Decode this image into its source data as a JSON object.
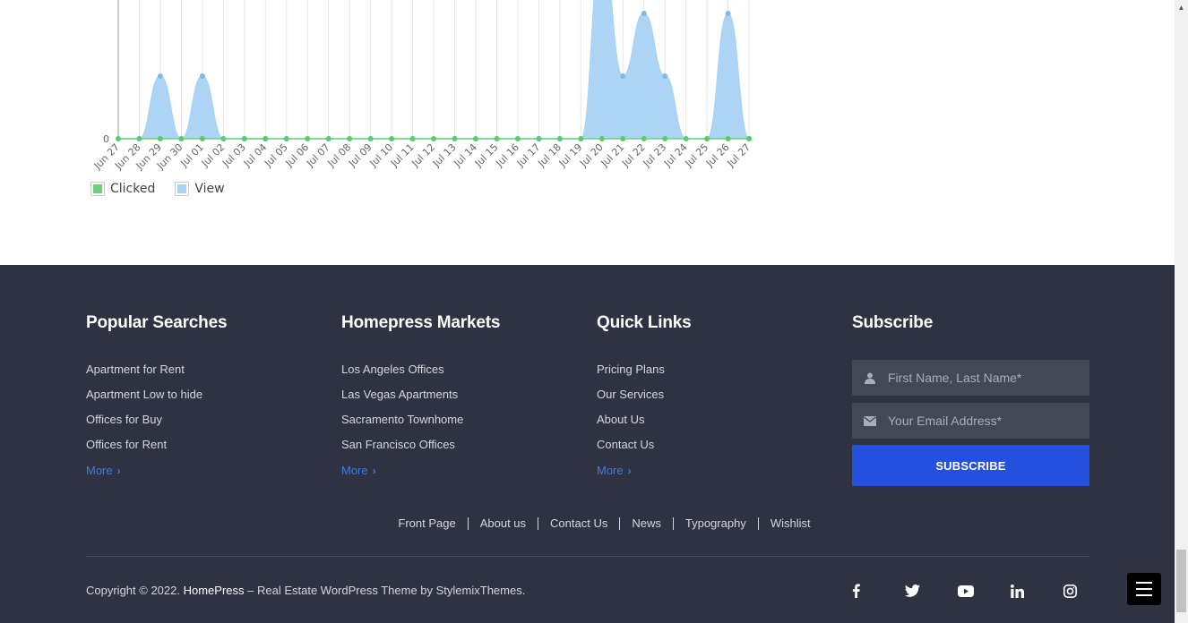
{
  "chart_data": {
    "type": "area",
    "x": [
      "Jun 27",
      "Jun 28",
      "Jun 29",
      "Jun 30",
      "Jul 01",
      "Jul 02",
      "Jul 03",
      "Jul 04",
      "Jul 05",
      "Jul 06",
      "Jul 07",
      "Jul 08",
      "Jul 09",
      "Jul 10",
      "Jul 11",
      "Jul 12",
      "Jul 13",
      "Jul 14",
      "Jul 15",
      "Jul 16",
      "Jul 17",
      "Jul 18",
      "Jul 19",
      "Jul 20",
      "Jul 21",
      "Jul 22",
      "Jul 23",
      "Jul 24",
      "Jul 25",
      "Jul 26",
      "Jul 27"
    ],
    "series": [
      {
        "name": "Clicked",
        "color": "#6dd27c",
        "values": [
          0,
          0,
          0,
          0,
          0,
          0,
          0,
          0,
          0,
          0,
          0,
          0,
          0,
          0,
          0,
          0,
          0,
          0,
          0,
          0,
          0,
          0,
          0,
          0,
          0,
          0,
          0,
          0,
          0,
          0,
          0
        ]
      },
      {
        "name": "View",
        "color": "#a9d2f3",
        "values": [
          0,
          0,
          1,
          0,
          1,
          0,
          0,
          0,
          0,
          0,
          0,
          0,
          0,
          0,
          0,
          0,
          0,
          0,
          0,
          0,
          0,
          0,
          0,
          3,
          1,
          2,
          1,
          0,
          0,
          2,
          0
        ]
      }
    ],
    "yticks": [
      "0"
    ],
    "ymin": 0,
    "legend": "bottom-left"
  },
  "legend": {
    "clicked_label": "Clicked",
    "view_label": "View"
  },
  "footer": {
    "popular": {
      "title": "Popular Searches",
      "items": [
        "Apartment for Rent",
        "Apartment Low to hide",
        "Offices for Buy",
        "Offices for Rent"
      ],
      "more": "More"
    },
    "markets": {
      "title": "Homepress Markets",
      "items": [
        "Los Angeles Offices",
        "Las Vegas Apartments",
        "Sacramento Townhome",
        "San Francisco Offices"
      ],
      "more": "More"
    },
    "quick": {
      "title": "Quick Links",
      "items": [
        "Pricing Plans",
        "Our Services",
        "About Us",
        "Contact Us"
      ],
      "more": "More"
    },
    "subscribe": {
      "title": "Subscribe",
      "name_placeholder": "First Name, Last Name*",
      "email_placeholder": "Your Email Address*",
      "button": "SUBSCRIBE"
    },
    "nav": [
      "Front Page",
      "About us",
      "Contact Us",
      "News",
      "Typography",
      "Wishlist"
    ],
    "copyright_prefix": "Copyright © 2022. ",
    "copyright_brand": "HomePress",
    "copyright_suffix": " – Real Estate WordPress Theme by StylemixThemes.",
    "social": [
      "facebook-icon",
      "twitter-icon",
      "youtube-icon",
      "linkedin-icon",
      "instagram-icon"
    ]
  }
}
